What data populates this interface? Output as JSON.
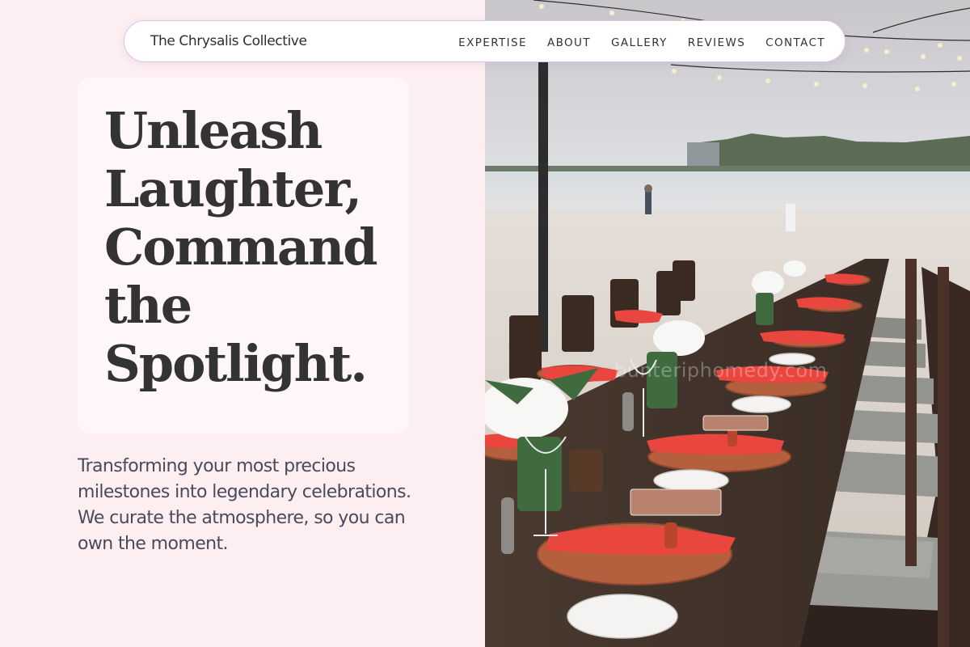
{
  "navbar": {
    "brand": "The Chrysalis Collective",
    "links": [
      "EXPERTISE",
      "ABOUT",
      "GALLERY",
      "REVIEWS",
      "CONTACT"
    ]
  },
  "hero": {
    "headline_lines": [
      "Unleash",
      "Laughter,",
      "Command",
      "the",
      "Spotlight."
    ],
    "description": "Transforming your most precious milestones into legendary celebrations. We curate the atmosphere, so you can own the moment."
  },
  "photo": {
    "subject": "beach dinner table with red napkins and string lights",
    "watermark": "bunteriphomedy.com"
  },
  "colors": {
    "page_background": "#fdeef2",
    "card_background": "#fff6f8",
    "navbar_border": "#d9c3e6",
    "headline_text": "#333333",
    "body_text": "#4a4a5a",
    "napkin_red": "#e8463e"
  }
}
